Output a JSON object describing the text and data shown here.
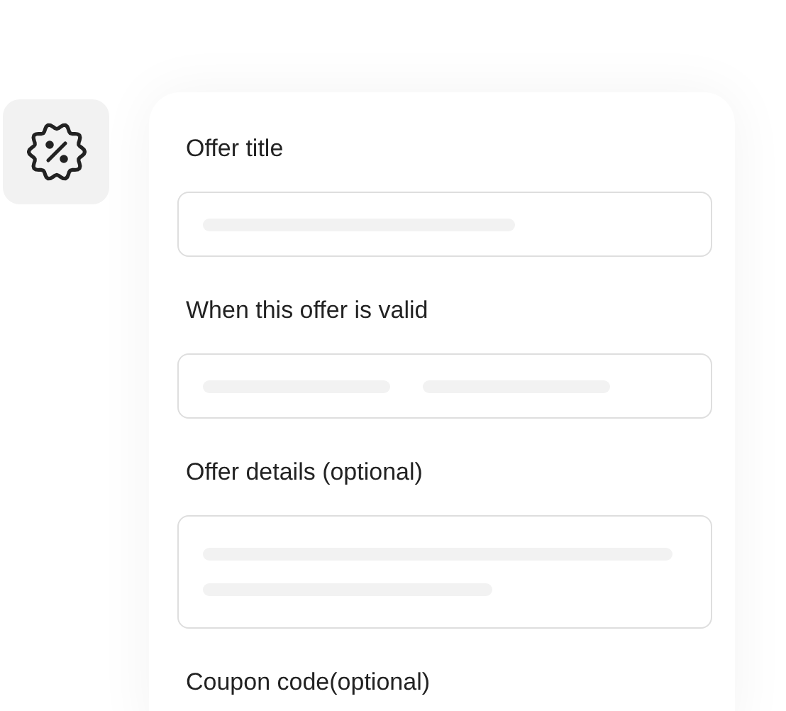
{
  "fields": [
    {
      "label": "Offer title",
      "kind": "single"
    },
    {
      "label": "When this offer is valid",
      "kind": "range"
    },
    {
      "label": "Offer details (optional)",
      "kind": "multiline"
    },
    {
      "label": "Coupon code(optional)",
      "kind": "cut"
    }
  ]
}
